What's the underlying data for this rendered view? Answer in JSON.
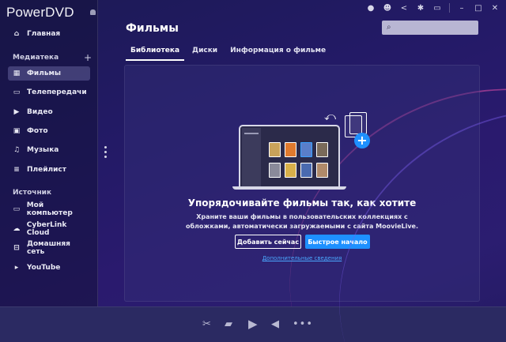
{
  "app": {
    "title": "PowerDVD"
  },
  "sidebar": {
    "home": "Главная",
    "section_library": "Медиатека",
    "library_items": [
      {
        "label": "Фильмы",
        "icon": "film-icon",
        "active": true
      },
      {
        "label": "Телепередачи",
        "icon": "tv-icon",
        "active": false
      },
      {
        "label": "Видео",
        "icon": "video-icon",
        "active": false
      },
      {
        "label": "Фото",
        "icon": "photo-icon",
        "active": false
      },
      {
        "label": "Музыка",
        "icon": "music-icon",
        "active": false
      },
      {
        "label": "Плейлист",
        "icon": "playlist-icon",
        "active": false
      }
    ],
    "section_source": "Источник",
    "source_items": [
      {
        "label": "Мой компьютер",
        "icon": "computer-icon"
      },
      {
        "label": "CyberLink Cloud",
        "icon": "cloud-icon"
      },
      {
        "label": "Домашняя сеть",
        "icon": "network-icon"
      },
      {
        "label": "YouTube",
        "icon": "youtube-icon"
      }
    ]
  },
  "main": {
    "title": "Фильмы",
    "search_placeholder": "",
    "tabs": [
      {
        "label": "Библиотека",
        "active": true
      },
      {
        "label": "Диски",
        "active": false
      },
      {
        "label": "Информация о фильме",
        "active": false
      }
    ],
    "empty_state": {
      "heading": "Упорядочивайте фильмы так, как хотите",
      "description_line1": "Храните ваши фильмы в пользовательских коллекциях с",
      "description_line2": "обложками, автоматически загружаемыми с сайта MoovieLive.",
      "add_now": "Добавить сейчас",
      "quick_start": "Быстрое начало",
      "more_info": "Дополнительные сведения"
    }
  },
  "colors": {
    "accent": "#1e90ff",
    "link": "#4aa8ff",
    "background": "#231a66"
  }
}
